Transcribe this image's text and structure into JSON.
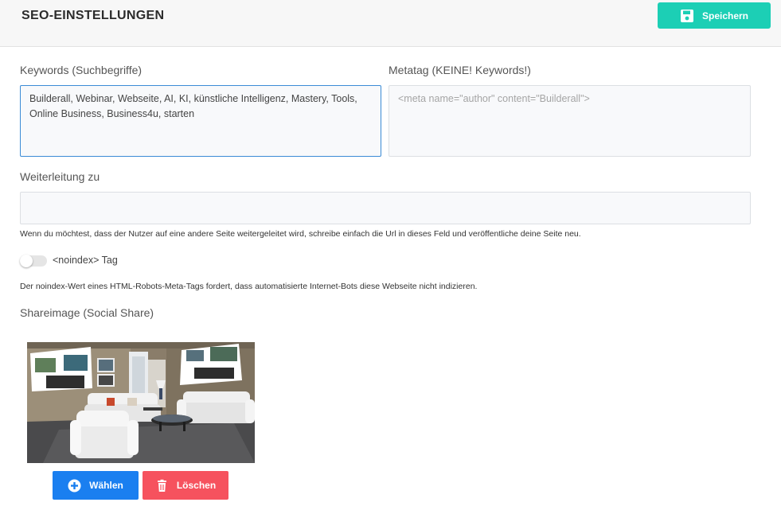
{
  "header": {
    "title": "SEO-EINSTELLUNGEN",
    "save_label": "Speichern"
  },
  "keywords": {
    "label": "Keywords (Suchbegriffe)",
    "value": "Builderall, Webinar, Webseite, AI, KI, künstliche Intelligenz, Mastery, Tools, Online Business, Business4u, starten"
  },
  "metatag": {
    "label": "Metatag (KEINE! Keywords!)",
    "placeholder": "<meta name=\"author\" content=\"Builderall\">"
  },
  "redirect": {
    "label": "Weiterleitung zu",
    "value": "",
    "hint": "Wenn du möchtest, dass der Nutzer auf eine andere Seite weitergeleitet wird, schreibe einfach die Url in dieses Feld und veröffentliche deine Seite neu."
  },
  "noindex": {
    "label": "<noindex> Tag",
    "enabled": false,
    "hint": "Der noindex-Wert eines HTML-Robots-Meta-Tags fordert, dass automatisierte Internet-Bots diese Webseite nicht indizieren."
  },
  "shareimage": {
    "label": "Shareimage (Social Share)",
    "choose_label": "Wählen",
    "delete_label": "Löschen"
  },
  "colors": {
    "save": "#1ccfb5",
    "choose": "#1a7ff0",
    "delete": "#f6525e",
    "focus_border": "#3b8bd6"
  },
  "icons": {
    "save": "floppy-disk-icon",
    "choose": "plus-circle-icon",
    "delete": "trash-icon"
  }
}
